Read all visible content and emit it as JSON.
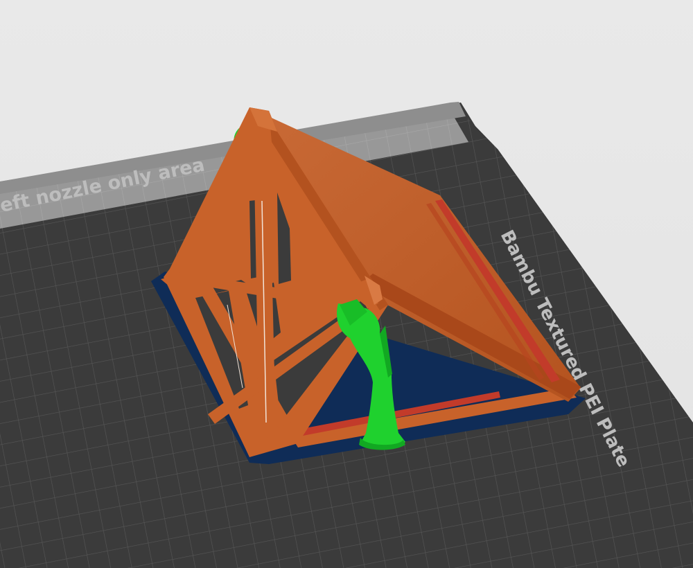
{
  "viewport": {
    "left_nozzle_label": "eft nozzle only area",
    "plate_label": "Bambu Textured PEI Plate"
  },
  "colors": {
    "background": "#e6e6e6",
    "plate": "#3b3b3b",
    "plate_grid": "#555555",
    "nozzle_strip": "#9a9a9a",
    "part_orange": "#c8622a",
    "support_green": "#1fd12e",
    "brim_blue": "#0f2c57",
    "infill_red": "#c23b2a"
  },
  "icons": {
    "print_part": "tent-model-icon",
    "supports": "tree-support-icon"
  }
}
